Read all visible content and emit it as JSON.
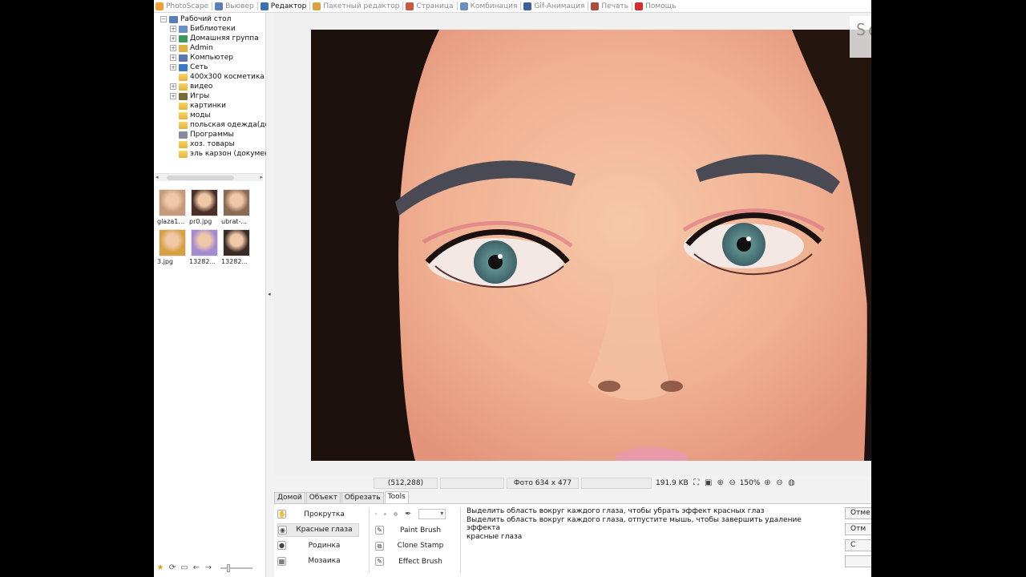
{
  "top_tabs": [
    {
      "label": "PhotoScape",
      "icon": "photoscape-icon",
      "color": "#f0a030"
    },
    {
      "label": "Вьювер",
      "icon": "viewer-icon",
      "color": "#5a7fb8"
    },
    {
      "label": "Редактор",
      "icon": "editor-icon",
      "color": "#3b6fb6",
      "active": true
    },
    {
      "label": "Пакетный редактор",
      "icon": "batch-editor-icon",
      "color": "#d8a23c"
    },
    {
      "label": "Страница",
      "icon": "page-icon",
      "color": "#c85b3c"
    },
    {
      "label": "Комбинация",
      "icon": "combine-icon",
      "color": "#6b8fc0"
    },
    {
      "label": "Gif-Анимация",
      "icon": "gif-icon",
      "color": "#3d5f9f"
    },
    {
      "label": "Печать",
      "icon": "print-icon",
      "color": "#b04a3a"
    },
    {
      "label": "Помощь",
      "icon": "help-icon",
      "color": "#d03030"
    }
  ],
  "watermark": "SoftFly.ru",
  "tree": [
    {
      "label": "Рабочий стол",
      "icon": "desktop-icon",
      "level": 0,
      "expander": "−"
    },
    {
      "label": "Библиотеки",
      "icon": "libraries-icon",
      "level": 1,
      "expander": "+"
    },
    {
      "label": "Домашняя группа",
      "icon": "homegroup-icon",
      "level": 1,
      "expander": "+"
    },
    {
      "label": "Admin",
      "icon": "user-folder-icon",
      "level": 1,
      "expander": "+"
    },
    {
      "label": "Компьютер",
      "icon": "computer-icon",
      "level": 1,
      "expander": "+"
    },
    {
      "label": "Сеть",
      "icon": "network-icon",
      "level": 1,
      "expander": "+"
    },
    {
      "label": "400x300 косметика",
      "icon": "folder-icon",
      "level": 1,
      "expander": ""
    },
    {
      "label": "видео",
      "icon": "folder-icon",
      "level": 1,
      "expander": "+"
    },
    {
      "label": "Игры",
      "icon": "games-icon",
      "level": 1,
      "expander": "+"
    },
    {
      "label": "картинки",
      "icon": "folder-icon",
      "level": 1,
      "expander": ""
    },
    {
      "label": "моды",
      "icon": "folder-icon",
      "level": 1,
      "expander": ""
    },
    {
      "label": "польская одежда(до",
      "icon": "folder-icon",
      "level": 1,
      "expander": ""
    },
    {
      "label": "Программы",
      "icon": "programs-icon",
      "level": 1,
      "expander": ""
    },
    {
      "label": "хоз. товары",
      "icon": "folder-icon",
      "level": 1,
      "expander": ""
    },
    {
      "label": "эль карзон (докумен",
      "icon": "folder-icon",
      "level": 1,
      "expander": ""
    }
  ],
  "thumbnails": [
    {
      "caption": "glaza1...",
      "tone": "#c59a7a"
    },
    {
      "caption": "pr0.jpg",
      "tone": "#4a3028"
    },
    {
      "caption": "ubrat-...",
      "tone": "#8a6a52"
    },
    {
      "caption": "3.jpg",
      "tone": "#d8a040"
    },
    {
      "caption": "13282...",
      "tone": "#a48ad0"
    },
    {
      "caption": "13282...",
      "tone": "#3a2a26"
    }
  ],
  "status": {
    "coords": "(512,288)",
    "photo_info": "Фото 634 x 477",
    "file_size": "191.9 KB",
    "zoom": "150%"
  },
  "bottom_tabs": [
    {
      "label": "Домой"
    },
    {
      "label": "Объект"
    },
    {
      "label": "Обрезать"
    },
    {
      "label": "Tools",
      "active": true
    }
  ],
  "tools_left": [
    {
      "label": "Прокрутка",
      "icon": "hand-icon",
      "symbol": "✋"
    },
    {
      "label": "Красные глаза",
      "icon": "red-eye-icon",
      "symbol": "◉",
      "selected": true
    },
    {
      "label": "Родинка",
      "icon": "mole-icon",
      "symbol": "●"
    },
    {
      "label": "Мозаика",
      "icon": "mosaic-icon",
      "symbol": "▦"
    }
  ],
  "tools_right": [
    {
      "label": "Paint Brush",
      "icon": "paint-brush-icon",
      "symbol": "✎"
    },
    {
      "label": "Clone Stamp",
      "icon": "clone-stamp-icon",
      "symbol": "⧉"
    },
    {
      "label": "Effect Brush",
      "icon": "effect-brush-icon",
      "symbol": "✎"
    }
  ],
  "help_lines": [
    "Выделить область вокруг каждого глаза, чтобы убрать эффект красных глаз",
    "Выделить область вокруг каждого глаза, отпустите мышь, чтобы завершить удаление эффекта",
    "красные глаза"
  ],
  "side_buttons": [
    "Отме",
    "Отм",
    "С"
  ]
}
